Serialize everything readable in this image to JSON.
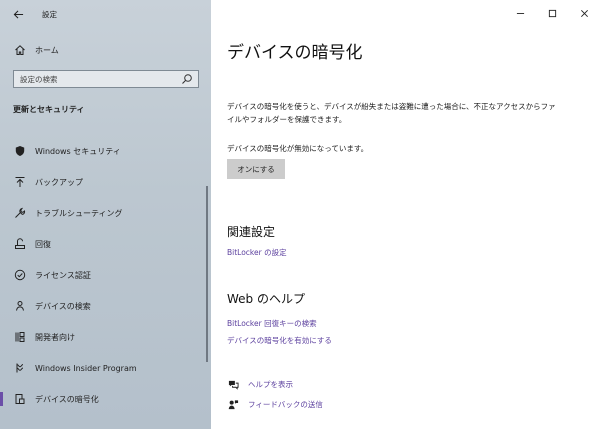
{
  "window": {
    "title": "設定"
  },
  "sidebar": {
    "home_label": "ホーム",
    "search_placeholder": "設定の検索",
    "section_title": "更新とセキュリティ",
    "items": [
      {
        "label": "Windows セキュリティ",
        "icon": "shield-icon"
      },
      {
        "label": "バックアップ",
        "icon": "backup-arrow-icon"
      },
      {
        "label": "トラブルシューティング",
        "icon": "wrench-icon"
      },
      {
        "label": "回復",
        "icon": "recovery-icon"
      },
      {
        "label": "ライセンス認証",
        "icon": "checkmark-circle-icon"
      },
      {
        "label": "デバイスの検索",
        "icon": "person-pin-icon"
      },
      {
        "label": "開発者向け",
        "icon": "developer-icon"
      },
      {
        "label": "Windows Insider Program",
        "icon": "insider-icon"
      },
      {
        "label": "デバイスの暗号化",
        "icon": "encryption-icon"
      }
    ],
    "selected": "デバイスの暗号化"
  },
  "main": {
    "title": "デバイスの暗号化",
    "description": "デバイスの暗号化を使うと、デバイスが紛失または盗難に遭った場合に、不正なアクセスからファイルやフォルダーを保護できます。",
    "status": "デバイスの暗号化が無効になっています。",
    "on_button": "オンにする",
    "related_heading": "関連設定",
    "related_link": "BitLocker の設定",
    "web_help_heading": "Web のヘルプ",
    "web_links": [
      "BitLocker 回復キーの検索",
      "デバイスの暗号化を有効にする"
    ],
    "help_link": "ヘルプを表示",
    "feedback_link": "フィードバックの送信"
  },
  "colors": {
    "link": "#5b3f9e",
    "accent": "#6b4ea8",
    "sidebar_bg": "#bcc7d0"
  }
}
